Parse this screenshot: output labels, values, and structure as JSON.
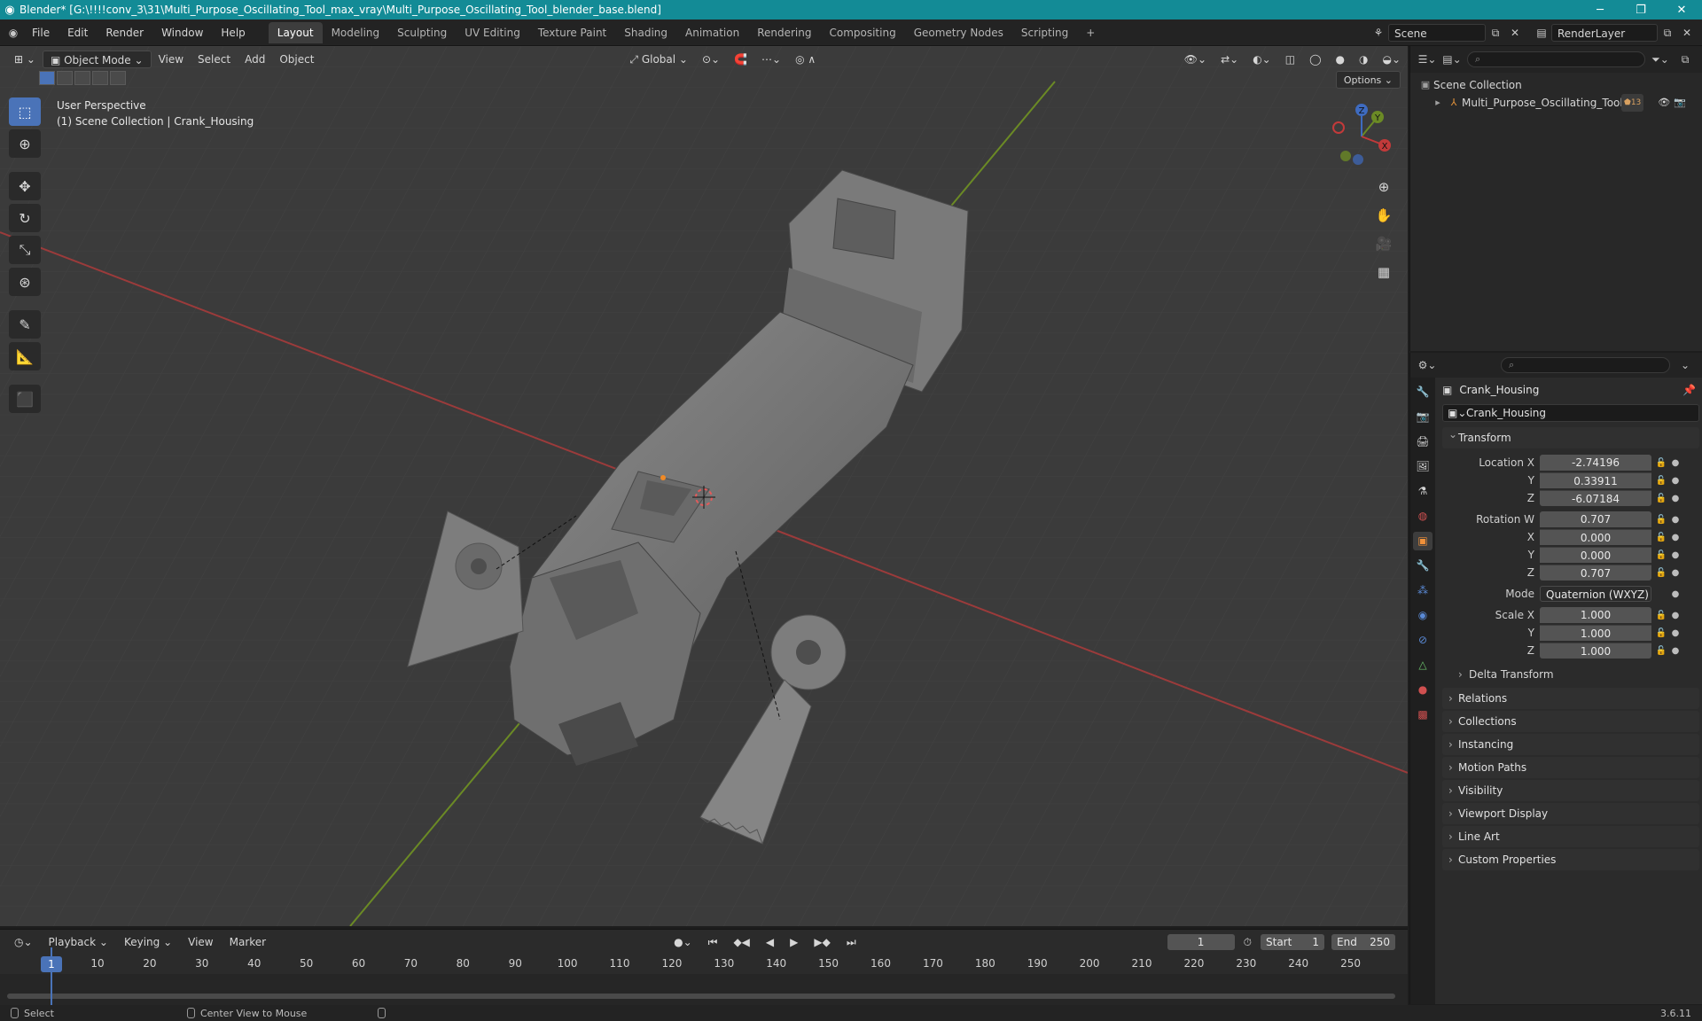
{
  "window": {
    "title": "Blender* [G:\\!!!!conv_3\\31\\Multi_Purpose_Oscillating_Tool_max_vray\\Multi_Purpose_Oscillating_Tool_blender_base.blend]",
    "minimize": "─",
    "maximize": "❐",
    "close": "✕"
  },
  "menu": {
    "items": [
      "File",
      "Edit",
      "Render",
      "Window",
      "Help"
    ],
    "workspaces": [
      "Layout",
      "Modeling",
      "Sculpting",
      "UV Editing",
      "Texture Paint",
      "Shading",
      "Animation",
      "Rendering",
      "Compositing",
      "Geometry Nodes",
      "Scripting"
    ],
    "active_workspace": "Layout",
    "add_tab": "+",
    "scene": "Scene",
    "render_layer": "RenderLayer"
  },
  "viewport": {
    "mode": "Object Mode",
    "menus": [
      "View",
      "Select",
      "Add",
      "Object"
    ],
    "transform_orientation": "Global",
    "options": "Options",
    "perspective": "User Perspective",
    "collection_info": "(1) Scene Collection | Crank_Housing",
    "gizmo": {
      "x": "X",
      "y": "Y",
      "z": "Z"
    }
  },
  "outliner": {
    "search_placeholder": "",
    "root": "Scene Collection",
    "items": [
      {
        "name": "Multi_Purpose_Oscillating_Tool",
        "badge": "13"
      }
    ]
  },
  "properties": {
    "object_name": "Crank_Housing",
    "datablock_name": "Crank_Housing",
    "transform_label": "Transform",
    "location_label": "Location X",
    "location": {
      "x": "-2.74196",
      "y": "0.33911",
      "z": "-6.07184"
    },
    "rotation_label": "Rotation W",
    "rotation": {
      "w": "0.707",
      "x": "0.000",
      "y": "0.000",
      "z": "0.707"
    },
    "mode_label": "Mode",
    "mode_value": "Quaternion (WXYZ)",
    "scale_label": "Scale X",
    "scale": {
      "x": "1.000",
      "y": "1.000",
      "z": "1.000"
    },
    "axis_y": "Y",
    "axis_z": "Z",
    "axis_x": "X",
    "delta_transform": "Delta Transform",
    "panels": [
      "Relations",
      "Collections",
      "Instancing",
      "Motion Paths",
      "Visibility",
      "Viewport Display",
      "Line Art",
      "Custom Properties"
    ]
  },
  "timeline": {
    "menus": [
      "Playback",
      "Keying",
      "View",
      "Marker"
    ],
    "current_frame": "1",
    "start_label": "Start",
    "start": "1",
    "end_label": "End",
    "end": "250",
    "ruler": [
      "10",
      "20",
      "30",
      "40",
      "50",
      "60",
      "70",
      "80",
      "90",
      "100",
      "110",
      "120",
      "130",
      "140",
      "150",
      "160",
      "170",
      "180",
      "190",
      "200",
      "210",
      "220",
      "230",
      "240",
      "250"
    ],
    "playhead": "1"
  },
  "status": {
    "select": "Select",
    "center_view": "Center View to Mouse",
    "version": "3.6.11"
  }
}
